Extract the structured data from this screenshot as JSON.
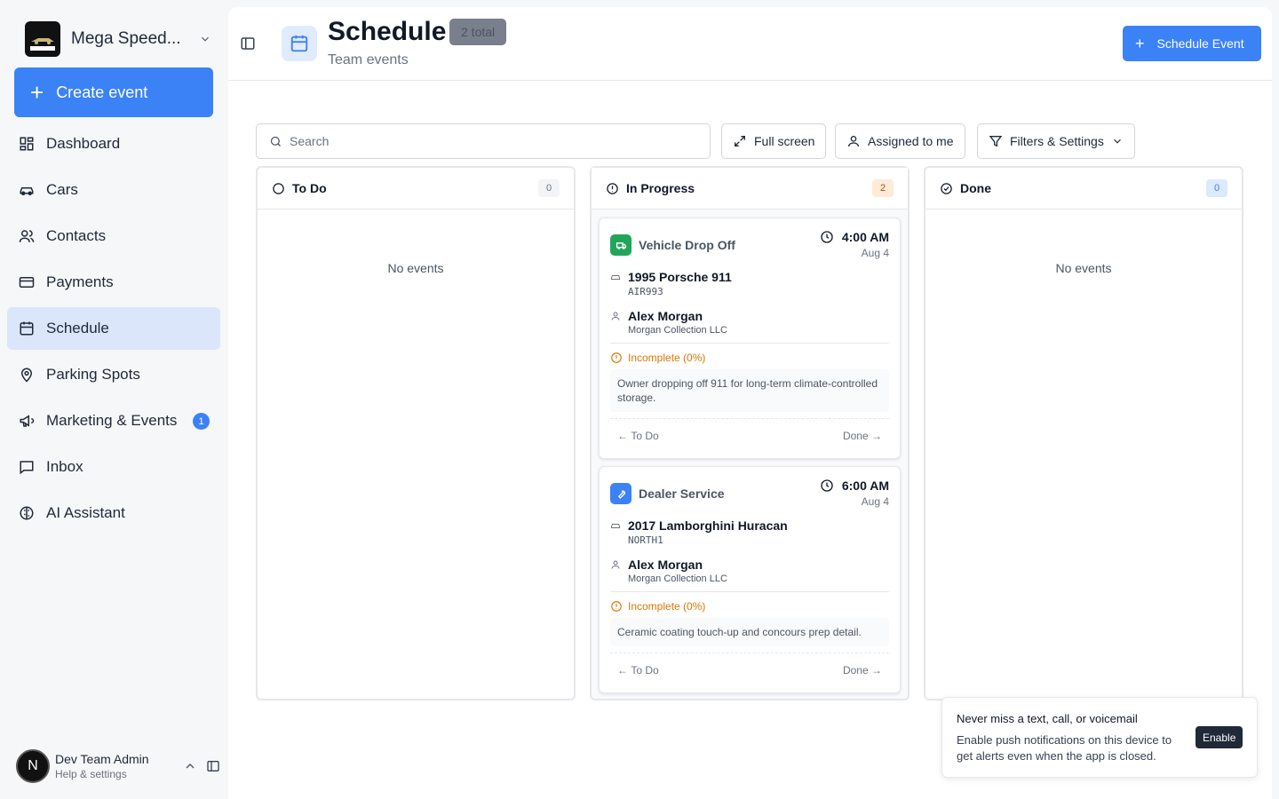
{
  "sidebar": {
    "brand": {
      "name": "Mega Speed...",
      "logo_text": "MEGA SPEED STORAGE"
    },
    "create_label": "Create event",
    "items": [
      {
        "label": "Dashboard",
        "icon": "dashboard-icon",
        "active": false
      },
      {
        "label": "Cars",
        "icon": "car-icon",
        "active": false
      },
      {
        "label": "Contacts",
        "icon": "contacts-icon",
        "active": false
      },
      {
        "label": "Payments",
        "icon": "credit-card-icon",
        "active": false
      },
      {
        "label": "Schedule",
        "icon": "calendar-icon",
        "active": true
      },
      {
        "label": "Parking Spots",
        "icon": "map-pin-icon",
        "active": false
      },
      {
        "label": "Marketing & Events",
        "icon": "megaphone-icon",
        "active": false,
        "badge": "1"
      },
      {
        "label": "Inbox",
        "icon": "message-icon",
        "active": false
      },
      {
        "label": "AI Assistant",
        "icon": "brain-icon",
        "active": false
      }
    ],
    "user": {
      "initial": "N",
      "name": "Dev Team Admin",
      "subtitle": "Help & settings"
    }
  },
  "header": {
    "title": "Schedule",
    "badge": "2 total",
    "subtitle": "Team events",
    "primary_button": "Schedule Event"
  },
  "toolbar": {
    "search_placeholder": "Search",
    "fullscreen_label": "Full screen",
    "assigned_label": "Assigned to me",
    "filters_label": "Filters & Settings"
  },
  "columns": [
    {
      "title": "To Do",
      "count": "0",
      "empty_text": "No events"
    },
    {
      "title": "In Progress",
      "count": "2"
    },
    {
      "title": "Done",
      "count": "0",
      "empty_text": "No events"
    }
  ],
  "events": [
    {
      "type": "Vehicle Drop Off",
      "type_color": "#22a55a",
      "time": "4:00 AM",
      "date": "Aug 4",
      "car": "1995 Porsche 911",
      "plate": "AIR993",
      "contact": "Alex Morgan",
      "company": "Morgan Collection LLC",
      "status": "Incomplete (0%)",
      "note": "Owner dropping off 911 for long-term climate-controlled storage.",
      "prev": "To Do",
      "next": "Done"
    },
    {
      "type": "Dealer Service",
      "type_color": "#3b82f6",
      "time": "6:00 AM",
      "date": "Aug 4",
      "car": "2017 Lamborghini Huracan",
      "plate": "NORTH1",
      "contact": "Alex Morgan",
      "company": "Morgan Collection LLC",
      "status": "Incomplete (0%)",
      "note": "Ceramic coating touch-up and concours prep detail.",
      "prev": "To Do",
      "next": "Done"
    }
  ],
  "toast": {
    "title": "Never miss a text, call, or voicemail",
    "body": "Enable push notifications on this device to get alerts even when the app is closed.",
    "button": "Enable"
  },
  "colors": {
    "accent": "#3b82f6",
    "active_nav": "#dbe6fb",
    "warning": "#d97706"
  }
}
